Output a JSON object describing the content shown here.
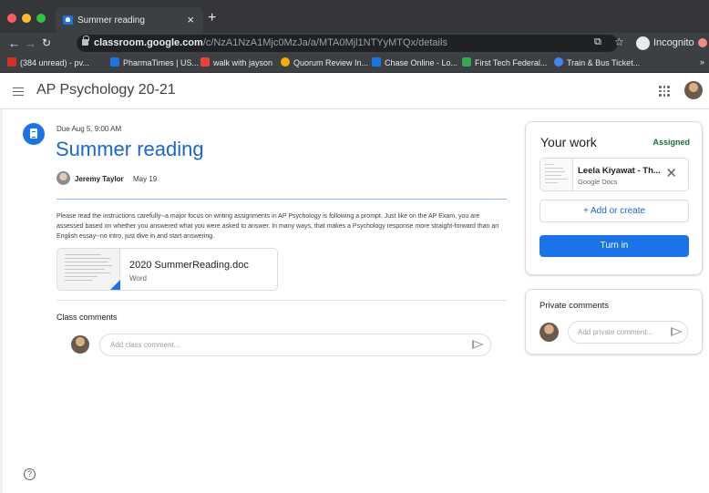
{
  "browser": {
    "tab_title": "Summer reading",
    "tab_close": "×",
    "new_tab": "+",
    "url_host": "classroom.google.com",
    "url_path": "/c/NzA1NzA1Mjc0MzJa/a/MTA0Mjl1NTYyMTQx/details",
    "incognito_label": "Incognito",
    "bookmarks": [
      {
        "label": "(384 unread) - pv...",
        "color": "#d93025"
      },
      {
        "label": "PharmaTimes | US...",
        "color": "#1a73e8"
      },
      {
        "label": "walk with jayson",
        "color": "#ea4335"
      },
      {
        "label": "Quorum Review In...",
        "color": "#f9ab00"
      },
      {
        "label": "Chase Online - Lo...",
        "color": "#1a73e8"
      },
      {
        "label": "First Tech Federal...",
        "color": "#34a853"
      },
      {
        "label": "Train & Bus Ticket...",
        "color": "#4285f4"
      }
    ],
    "bookmarks_overflow": "»"
  },
  "header": {
    "class_name": "AP Psychology 20-21"
  },
  "assignment": {
    "due": "Due Aug 5, 9:00 AM",
    "title": "Summer reading",
    "author": "Jeremy Taylor",
    "posted": "May 19",
    "description": "Please read the instructions carefully--a major focus on writing assignments in AP Psychology is following a prompt.  Just like on the AP Exam, you are assessed based on whether you answered what you were asked to answer.  In many ways, that makes a Psychology response more straight-forward than an English essay--no intro, just dive in and start answering.",
    "attachment": {
      "name": "2020 SummerReading.doc",
      "type": "Word"
    },
    "class_comments_label": "Class comments",
    "class_comment_placeholder": "Add class comment..."
  },
  "your_work": {
    "title": "Your work",
    "status": "Assigned",
    "status_color": "#137333",
    "file": {
      "name": "Leela Kiyawat - Th...",
      "type": "Google Docs"
    },
    "add_create": "+ Add or create",
    "turn_in": "Turn in",
    "accent": "#1a73e8"
  },
  "private_comments": {
    "title": "Private comments",
    "placeholder": "Add private comment..."
  },
  "help": "?"
}
